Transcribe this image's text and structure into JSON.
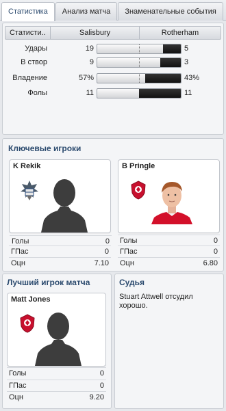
{
  "tabs": [
    {
      "label": "Статистика",
      "active": true
    },
    {
      "label": "Анализ матча",
      "active": false
    },
    {
      "label": "Знаменательные события",
      "active": false
    }
  ],
  "stats": {
    "header": {
      "label": "Статисти..",
      "home": "Salisbury",
      "away": "Rotherham"
    },
    "rows": [
      {
        "label": "Удары",
        "home": "19",
        "away": "5",
        "away_share": 0.21
      },
      {
        "label": "В створ",
        "home": "9",
        "away": "3",
        "away_share": 0.25
      },
      {
        "label": "Владение",
        "home": "57%",
        "away": "43%",
        "away_share": 0.43
      },
      {
        "label": "Фолы",
        "home": "11",
        "away": "11",
        "away_share": 0.5
      }
    ]
  },
  "key_players": {
    "title": "Ключевые игроки",
    "home": {
      "name": "K Rekik",
      "stats": [
        {
          "k": "Голы",
          "v": "0"
        },
        {
          "k": "ГПас",
          "v": "0"
        },
        {
          "k": "Оцн",
          "v": "7.10"
        }
      ]
    },
    "away": {
      "name": "B Pringle",
      "stats": [
        {
          "k": "Голы",
          "v": "0"
        },
        {
          "k": "ГПас",
          "v": "0"
        },
        {
          "k": "Оцн",
          "v": "6.80"
        }
      ]
    }
  },
  "motm": {
    "title": "Лучший игрок матча",
    "name": "Matt Jones",
    "stats": [
      {
        "k": "Голы",
        "v": "0"
      },
      {
        "k": "ГПас",
        "v": "0"
      },
      {
        "k": "Оцн",
        "v": "9.20"
      }
    ]
  },
  "referee": {
    "title": "Судья",
    "text": "Stuart Attwell отсудил хорошо."
  },
  "colors": {
    "accent": "#2b4a6e",
    "bar_fill": "#1a1a1a",
    "rotherham_red": "#c8102e"
  }
}
